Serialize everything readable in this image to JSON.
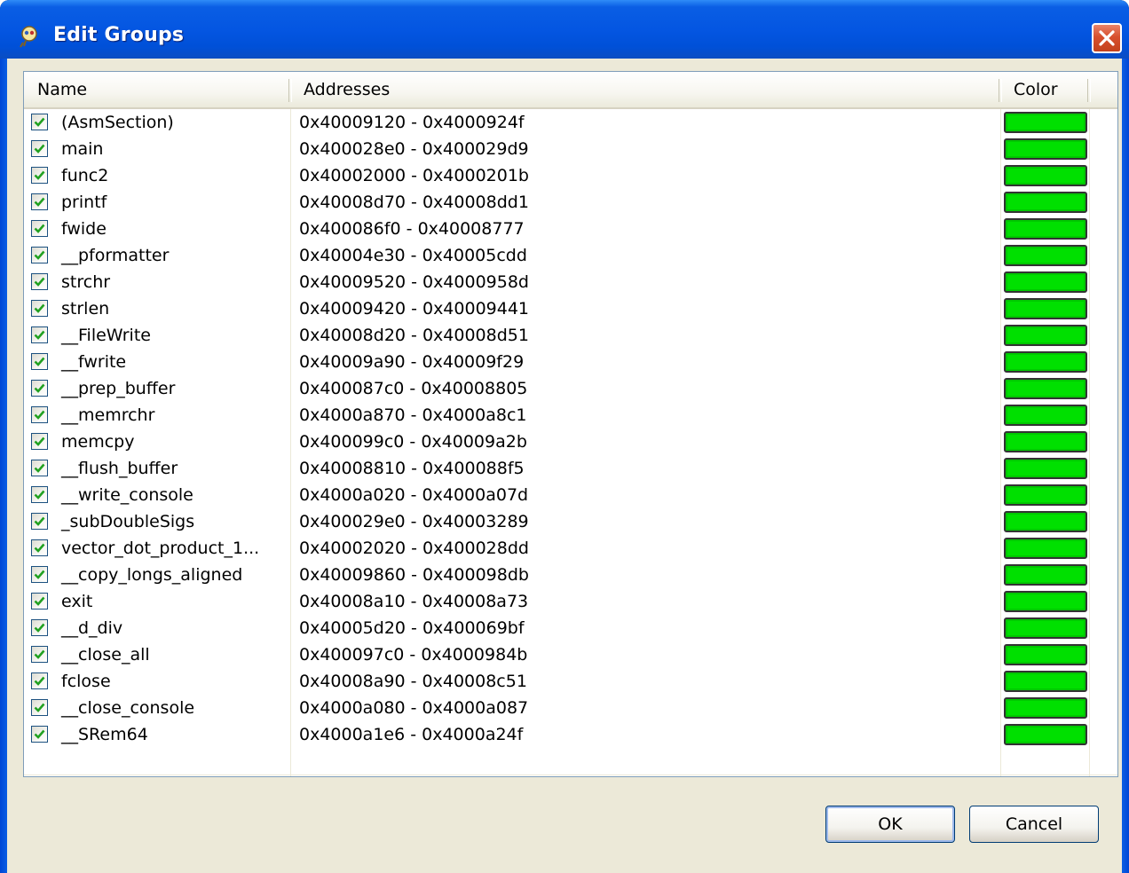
{
  "window": {
    "title": "Edit Groups"
  },
  "table": {
    "columns": {
      "name": "Name",
      "addresses": "Addresses",
      "color": "Color"
    },
    "rows": [
      {
        "checked": true,
        "name": "(AsmSection)",
        "addresses": "0x40009120 - 0x4000924f",
        "color": "#00e000"
      },
      {
        "checked": true,
        "name": "main",
        "addresses": "0x400028e0 - 0x400029d9",
        "color": "#00e000"
      },
      {
        "checked": true,
        "name": "func2",
        "addresses": "0x40002000 - 0x4000201b",
        "color": "#00e000"
      },
      {
        "checked": true,
        "name": "printf",
        "addresses": "0x40008d70 - 0x40008dd1",
        "color": "#00e000"
      },
      {
        "checked": true,
        "name": "fwide",
        "addresses": "0x400086f0 - 0x40008777",
        "color": "#00e000"
      },
      {
        "checked": true,
        "name": "__pformatter",
        "addresses": "0x40004e30 - 0x40005cdd",
        "color": "#00e000"
      },
      {
        "checked": true,
        "name": "strchr",
        "addresses": "0x40009520 - 0x4000958d",
        "color": "#00e000"
      },
      {
        "checked": true,
        "name": "strlen",
        "addresses": "0x40009420 - 0x40009441",
        "color": "#00e000"
      },
      {
        "checked": true,
        "name": "__FileWrite",
        "addresses": "0x40008d20 - 0x40008d51",
        "color": "#00e000"
      },
      {
        "checked": true,
        "name": "__fwrite",
        "addresses": "0x40009a90 - 0x40009f29",
        "color": "#00e000"
      },
      {
        "checked": true,
        "name": "__prep_buffer",
        "addresses": "0x400087c0 - 0x40008805",
        "color": "#00e000"
      },
      {
        "checked": true,
        "name": "__memrchr",
        "addresses": "0x4000a870 - 0x4000a8c1",
        "color": "#00e000"
      },
      {
        "checked": true,
        "name": "memcpy",
        "addresses": "0x400099c0 - 0x40009a2b",
        "color": "#00e000"
      },
      {
        "checked": true,
        "name": "__flush_buffer",
        "addresses": "0x40008810 - 0x400088f5",
        "color": "#00e000"
      },
      {
        "checked": true,
        "name": "__write_console",
        "addresses": "0x4000a020 - 0x4000a07d",
        "color": "#00e000"
      },
      {
        "checked": true,
        "name": "_subDoubleSigs",
        "addresses": "0x400029e0 - 0x40003289",
        "color": "#00e000"
      },
      {
        "checked": true,
        "name": "vector_dot_product_1...",
        "addresses": "0x40002020 - 0x400028dd",
        "color": "#00e000"
      },
      {
        "checked": true,
        "name": "__copy_longs_aligned",
        "addresses": "0x40009860 - 0x400098db",
        "color": "#00e000"
      },
      {
        "checked": true,
        "name": "exit",
        "addresses": "0x40008a10 - 0x40008a73",
        "color": "#00e000"
      },
      {
        "checked": true,
        "name": "__d_div",
        "addresses": "0x40005d20 - 0x400069bf",
        "color": "#00e000"
      },
      {
        "checked": true,
        "name": "__close_all",
        "addresses": "0x400097c0 - 0x4000984b",
        "color": "#00e000"
      },
      {
        "checked": true,
        "name": "fclose",
        "addresses": "0x40008a90 - 0x40008c51",
        "color": "#00e000"
      },
      {
        "checked": true,
        "name": "__close_console",
        "addresses": "0x4000a080 - 0x4000a087",
        "color": "#00e000"
      },
      {
        "checked": true,
        "name": "__SRem64",
        "addresses": "0x4000a1e6 - 0x4000a24f",
        "color": "#00e000"
      }
    ]
  },
  "buttons": {
    "ok": "OK",
    "cancel": "Cancel"
  },
  "icons": {
    "title": "groups-icon",
    "close": "close-icon",
    "check": "checkmark-icon"
  }
}
